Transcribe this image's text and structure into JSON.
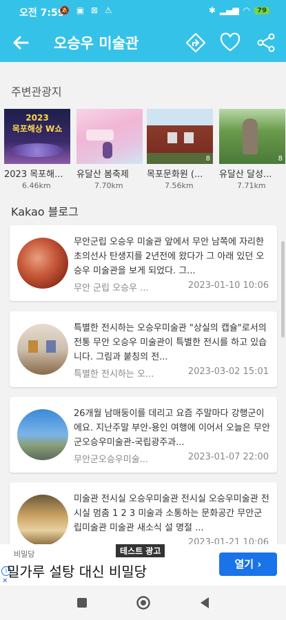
{
  "status_bar": {
    "time": "오전 7:59",
    "battery": "79"
  },
  "app_bar": {
    "title": "오승우 미술관",
    "icons": [
      "back-arrow-icon",
      "directions-icon",
      "heart-icon",
      "share-icon"
    ]
  },
  "nearby": {
    "title": "주변관광지",
    "items": [
      {
        "name": "2023 목포해...",
        "distance": "6.46km",
        "thumb_text": "2023\n목포해상 W쇼"
      },
      {
        "name": "유달산 봄축제",
        "distance": "7.70km"
      },
      {
        "name": "목포문화원 (...",
        "distance": "7.56km",
        "index": "8"
      },
      {
        "name": "유달산 달성...",
        "distance": "7.71km",
        "index": "8"
      }
    ]
  },
  "blog": {
    "title": "Kakao 블로그",
    "posts": [
      {
        "text": "무안군립 오승우 미술관 앞에서  무안 남쪽에 자리한 초의선사 탄생지를 2년전에 왔다가 그 아래 있던 오승우 미술관을 보게 되었다. 그...",
        "author": "무안 군립 오승우 ...",
        "date": "2023-01-10 10:06"
      },
      {
        "text": "특별한 전시하는 오승우미술관 \"상실의 캡슐\"로서의 전통 무안 오승우 미술관이 특별한 전시를 하고 있습니다. 그림과 붙칭의 전...",
        "author": "특별한 전시하는 오...",
        "date": "2023-03-02 15:01"
      },
      {
        "text": " 26개월 남매둥이를 데리고 요즘 주말마다 강행군이에요.  지난주말 부안-용인 여행에 이어서 오늘은 무안군오승우미술관-국립광주과...",
        "author": "무안군오승우미술...",
        "date": "2023-01-07 22:00"
      },
      {
        "text": "미술관 전시실 오승우미술관 전시실 오승우미술관 전시실 멈춤 1 2 3 미술과 소통하는 문화공간 무안군립미술관 미술관 새소식 설 명절 ...",
        "author": "",
        "date": "2023-01-21 10:06"
      }
    ]
  },
  "ad": {
    "tag": "테스트 광고",
    "advertiser": "비밀당",
    "headline": "밀가루 설탕 대신 비밀당",
    "cta": "열기 ›",
    "info_icon": "i",
    "close_icon": "✕"
  },
  "colors": {
    "accent": "#35c2e8",
    "ad_button": "#1a73e8"
  }
}
